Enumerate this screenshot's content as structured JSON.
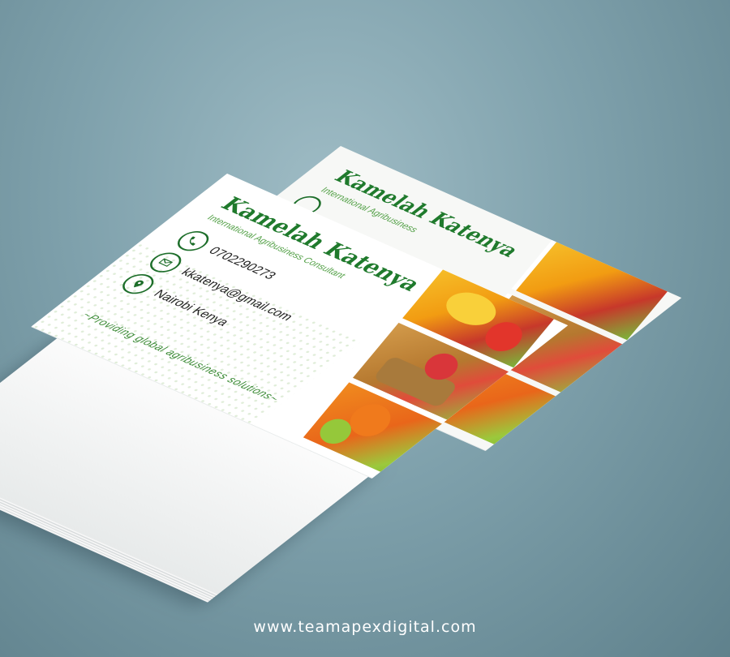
{
  "card": {
    "name": "Kamelah Katenya",
    "role": "International Agribusiness Consultant",
    "phone": "0702290273",
    "email": "kkatenya@gmail.com",
    "location": "Nairobi Kenya",
    "tagline": "~Providing global agribusiness solutions~",
    "back_name": "Kamelah Katenya",
    "back_role": "International Agribusiness"
  },
  "icons": {
    "phone": "phone-icon",
    "email": "envelope-icon",
    "location": "location-pin-icon"
  },
  "colors": {
    "brand_green": "#1f7a2c",
    "accent_green": "#56a24a",
    "background": "#7fa1ac"
  },
  "footer": {
    "website": "www.teamapexdigital.com"
  }
}
